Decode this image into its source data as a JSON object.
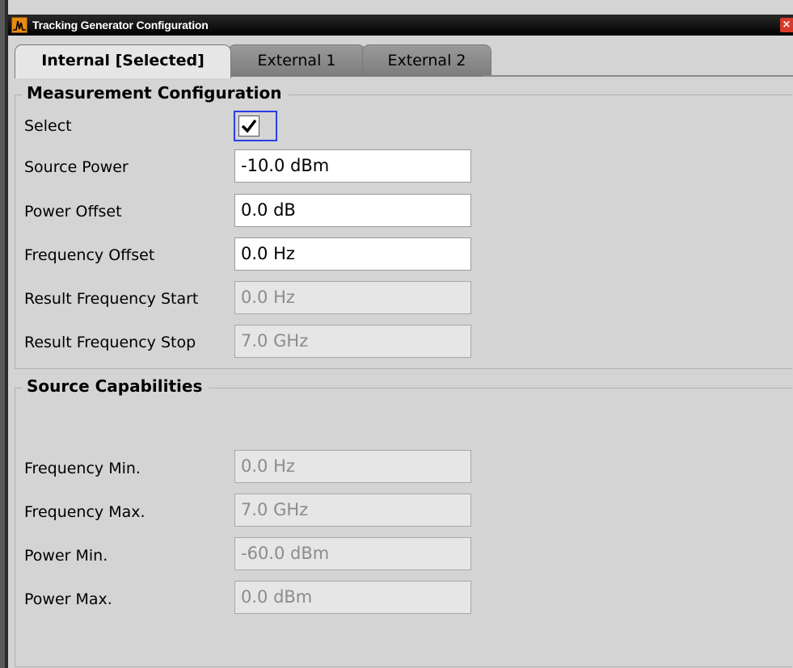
{
  "window": {
    "title": "Tracking Generator Configuration",
    "close_glyph": "×"
  },
  "tabs": [
    {
      "label": "Internal [Selected]",
      "active": true
    },
    {
      "label": "External 1",
      "active": false
    },
    {
      "label": "External 2",
      "active": false
    }
  ],
  "measurement": {
    "title": "Measurement Configuration",
    "select_label": "Select",
    "select_checked": true,
    "fields": [
      {
        "label": "Source Power",
        "value": "-10.0 dBm",
        "editable": true
      },
      {
        "label": "Power Offset",
        "value": "0.0 dB",
        "editable": true
      },
      {
        "label": "Frequency Offset",
        "value": "0.0 Hz",
        "editable": true
      },
      {
        "label": "Result Frequency Start",
        "value": "0.0 Hz",
        "editable": false
      },
      {
        "label": "Result Frequency Stop",
        "value": "7.0 GHz",
        "editable": false
      }
    ]
  },
  "capabilities": {
    "title": "Source Capabilities",
    "fields": [
      {
        "label": "Frequency Min.",
        "value": "0.0 Hz"
      },
      {
        "label": "Frequency Max.",
        "value": "7.0 GHz"
      },
      {
        "label": "Power Min.",
        "value": "-60.0 dBm"
      },
      {
        "label": "Power Max.",
        "value": "0.0 dBm"
      }
    ]
  },
  "icons": {
    "app": "spectrum-icon",
    "close": "close-icon",
    "check": "checkmark-icon"
  },
  "colors": {
    "focus_border": "#2a3ee6",
    "close_button": "#d83a2a",
    "titlebar": "#000000",
    "panel": "#d4d4d4"
  }
}
